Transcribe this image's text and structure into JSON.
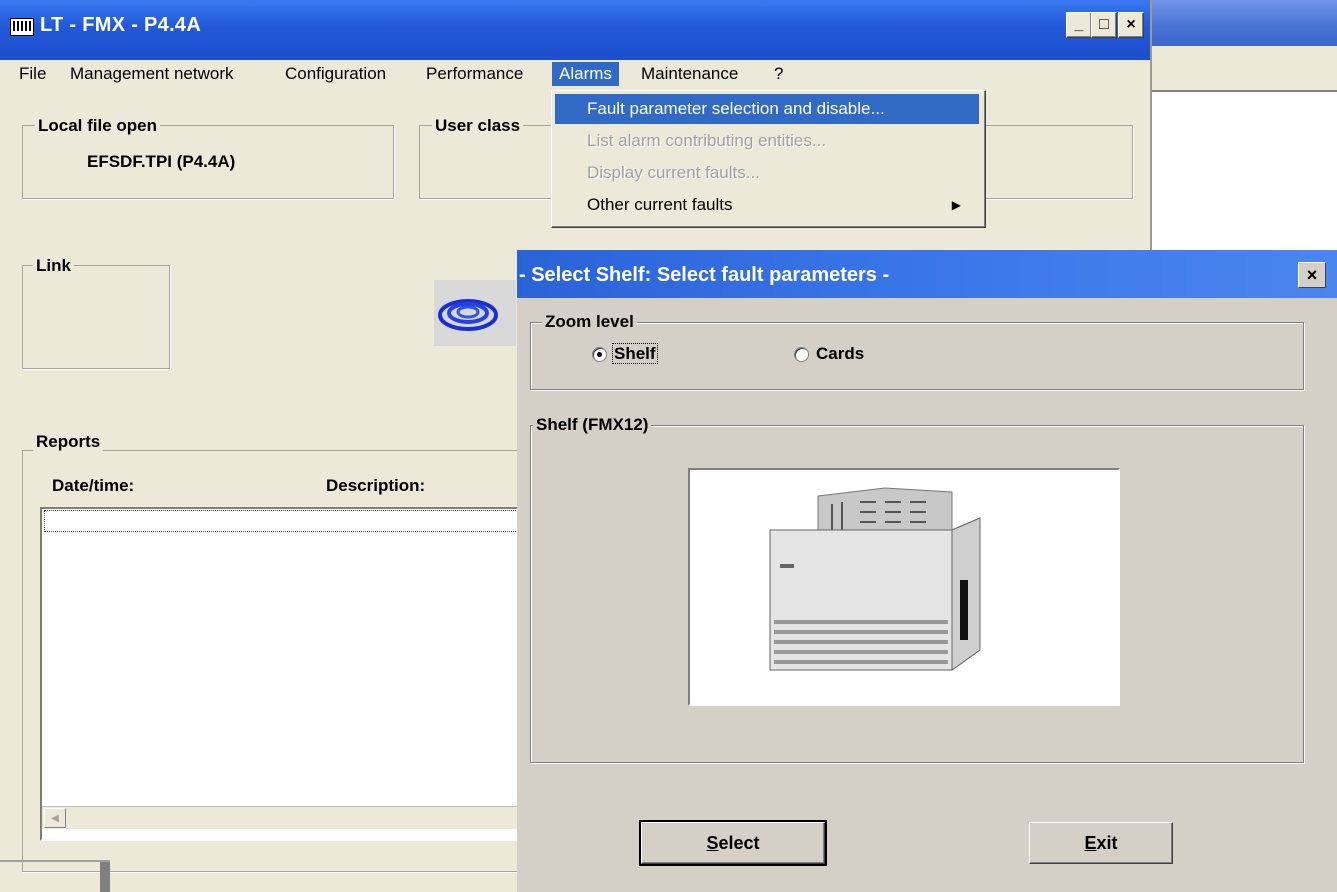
{
  "main_window": {
    "title": "LT - FMX - P4.4A",
    "controls": {
      "minimize": "_",
      "maximize": "□",
      "close": "×"
    }
  },
  "menu": {
    "items": [
      {
        "label": "File"
      },
      {
        "label": "Management network"
      },
      {
        "label": "Configuration"
      },
      {
        "label": "Performance"
      },
      {
        "label": "Alarms"
      },
      {
        "label": "Maintenance"
      },
      {
        "label": "?"
      }
    ],
    "active": "Alarms"
  },
  "alarms_menu": {
    "items": [
      {
        "label": "Fault parameter selection and disable...",
        "state": "highlighted"
      },
      {
        "label": "List alarm contributing entities...",
        "state": "disabled"
      },
      {
        "label": "Display current faults...",
        "state": "disabled"
      },
      {
        "label": "Other current faults",
        "state": "submenu",
        "arrow": "▶"
      }
    ]
  },
  "panels": {
    "local_file": {
      "label": "Local file open",
      "value": "EFSDF.TPI (P4.4A)"
    },
    "user_class": {
      "label": "User class"
    },
    "link": {
      "label": "Link"
    },
    "reports": {
      "label": "Reports",
      "columns": [
        "Date/time:",
        "Description:"
      ]
    }
  },
  "dialog": {
    "title": "- Select Shelf: Select fault parameters -",
    "close": "×",
    "zoom_level": {
      "label": "Zoom level",
      "options": [
        {
          "label": "Shelf",
          "checked": true
        },
        {
          "label": "Cards",
          "checked": false
        }
      ]
    },
    "shelf_group": {
      "label": "Shelf (FMX12)"
    },
    "buttons": {
      "select": {
        "accel": "S",
        "rest": "elect"
      },
      "exit": {
        "accel": "E",
        "rest": "xit"
      }
    }
  },
  "colors": {
    "titlebar": "#2359d8",
    "highlight": "#316ac5",
    "window_bg": "#ece9d8",
    "dialog_bg": "#d4d0c8"
  }
}
